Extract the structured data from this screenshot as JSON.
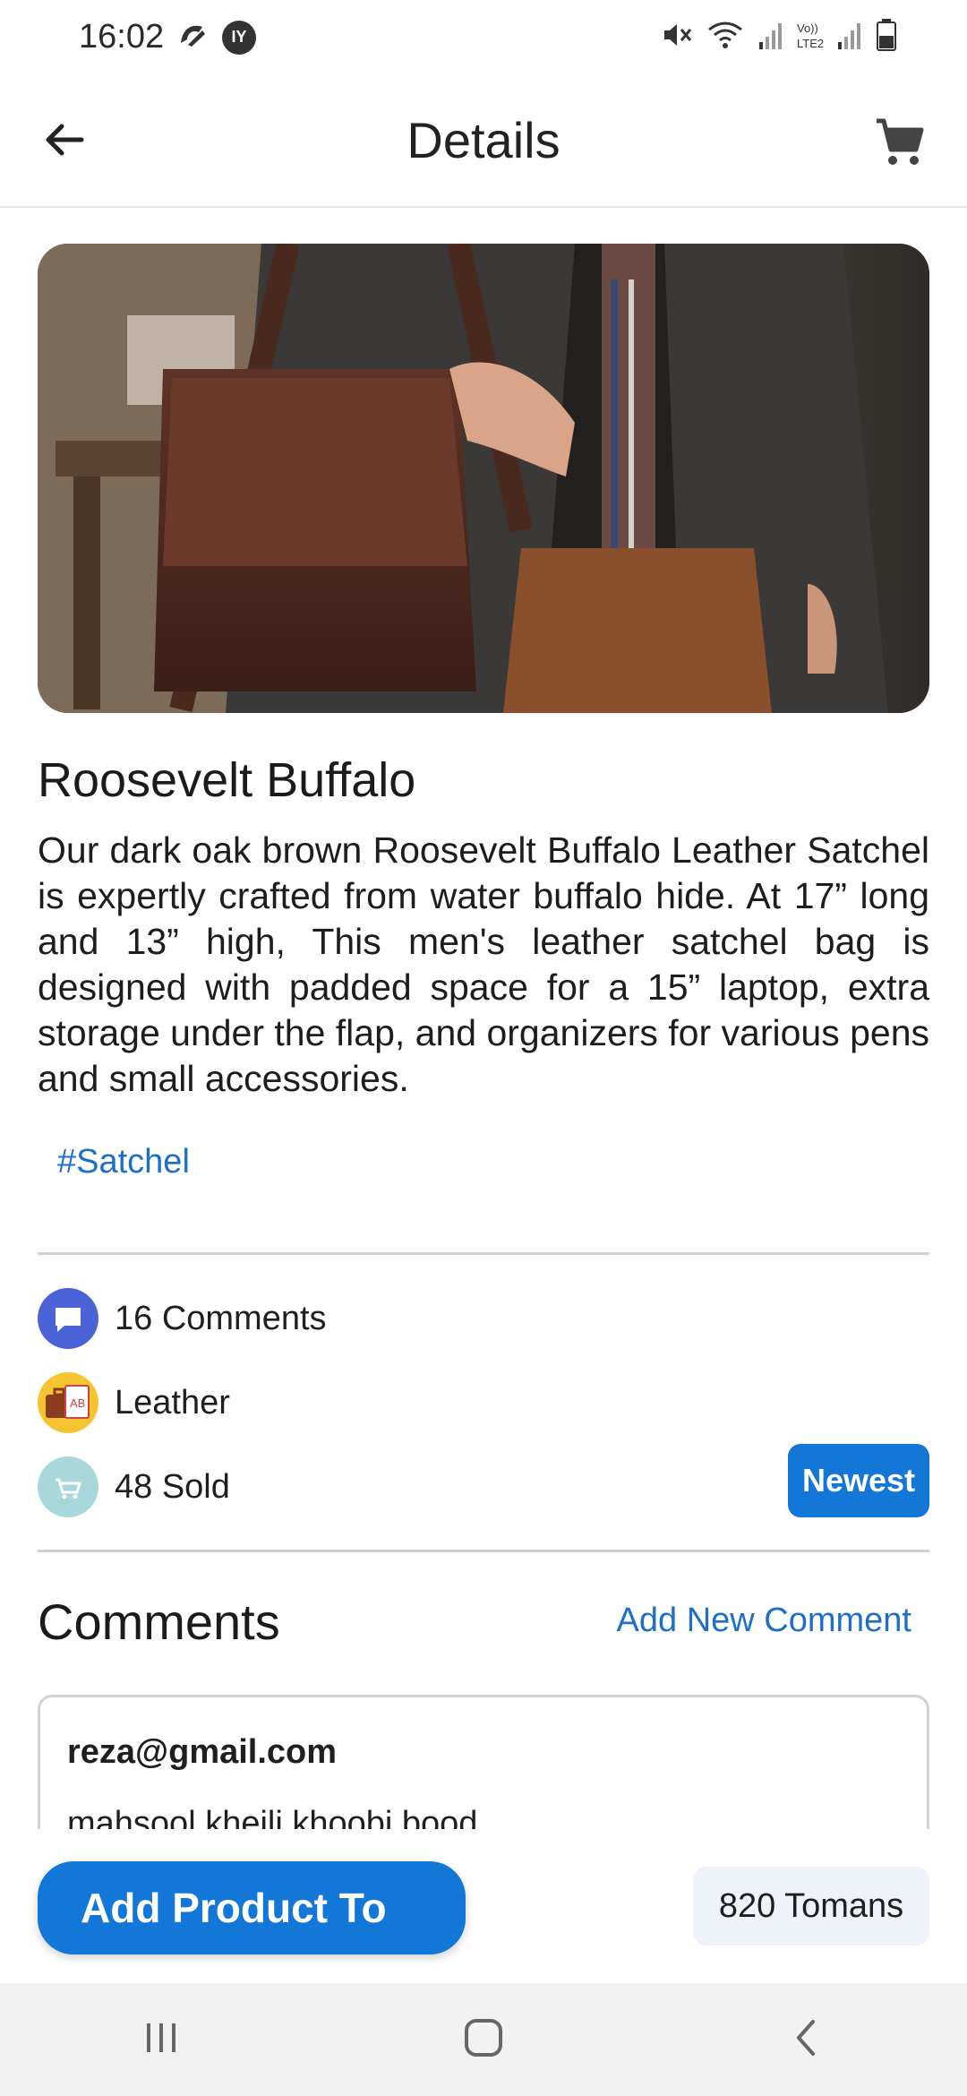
{
  "status_bar": {
    "time": "16:02",
    "icons": [
      "ny-icon",
      "circle-badge-icon",
      "mute-icon",
      "wifi-icon",
      "signal-icon",
      "lte2-signal-icon",
      "battery-icon"
    ],
    "badge_text": "IY"
  },
  "app_bar": {
    "title": "Details",
    "back_icon": "arrow-left-icon",
    "cart_icon": "shopping-cart-icon"
  },
  "product": {
    "title": "Roosevelt Buffalo",
    "description": "Our dark oak brown Roosevelt Buffalo Leather Satchel is expertly crafted from water buffalo hide. At 17” long and 13” high, This men's leather satchel bag is designed with padded space for a 15” laptop, extra storage under the flap, and organizers for various pens and small accessories.",
    "tag": "#Satchel"
  },
  "meta": {
    "comments": "16 Comments",
    "material": "Leather",
    "sold": "48 Sold",
    "newest_label": "Newest"
  },
  "comments_section": {
    "title": "Comments",
    "add_label": "Add New Comment",
    "items": [
      {
        "email": "reza@gmail.com",
        "text": "mahsool kheili khoobi bood"
      }
    ]
  },
  "actions": {
    "add_product_label": "Add Product To",
    "price": "820 Tomans"
  },
  "colors": {
    "accent": "#1277d6",
    "link": "#1e6fc7"
  }
}
